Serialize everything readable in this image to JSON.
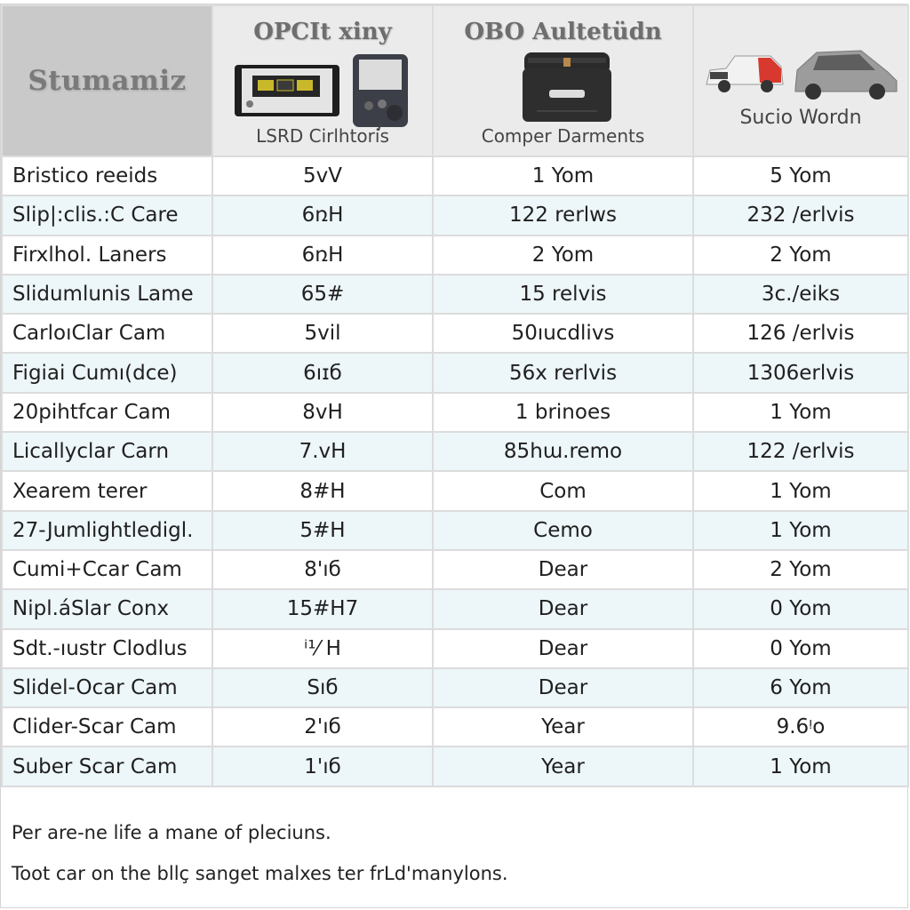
{
  "table": {
    "corner_title": "Stumamiz",
    "columns": [
      {
        "title": "OPCIt xiny",
        "subtitle": "LSRD Cirlhtoris",
        "image": "obd-scanner-devices-image"
      },
      {
        "title": "OBO Aultetüdn",
        "subtitle": "Comper Darments",
        "image": "obd-adapter-device-image"
      },
      {
        "title": "",
        "subtitle": "Sucio Wordn",
        "image": "cars-image"
      }
    ],
    "rows": [
      {
        "label": "Bristico reeids",
        "values": [
          "5vV",
          "1 Yom",
          "5 Yom"
        ]
      },
      {
        "label": "Slip|:clis.:C Care",
        "values": [
          "6ռH",
          "122 rerlws",
          "232 /erlvis"
        ]
      },
      {
        "label": "Firxlhol. Laners",
        "values": [
          "6ռH",
          "2 Yom",
          "2 Yom"
        ]
      },
      {
        "label": "Slidumlunis Lame",
        "values": [
          "65#",
          "15 relvis",
          "3c./eiks"
        ]
      },
      {
        "label": "CarloıClar Cam",
        "values": [
          "5vil",
          "50ıucdlivs",
          "126 /erlvis"
        ]
      },
      {
        "label": "Figiai Cumı(dce)",
        "values": [
          "6ıɪб",
          "56x rerlvis",
          "1306erlvis"
        ]
      },
      {
        "label": "20pihtfcar Cam",
        "values": [
          "8vH",
          "1 brinoes",
          "1 Yom"
        ]
      },
      {
        "label": "Licallyclar Carn",
        "values": [
          "7.vH",
          "85hɯ.remo",
          "122 /erlvis"
        ]
      },
      {
        "label": "Xearem terer",
        "values": [
          "8#H",
          "Com",
          "1 Yom"
        ]
      },
      {
        "label": "27-Jumlightledigl.",
        "values": [
          "5#H",
          "Cemo",
          "1 Yom"
        ]
      },
      {
        "label": "Cumi+Ccar Cam",
        "values": [
          "8'ıб",
          "Dear",
          "2 Yom"
        ]
      },
      {
        "label": "Nipl.áSlar Conx",
        "values": [
          "15#H7",
          "Dear",
          "0 Yom"
        ]
      },
      {
        "label": "Sdt.-ıustr Clodlus",
        "values": [
          "ⁱ¹⁄ H",
          "Dear",
          "0 Yom"
        ]
      },
      {
        "label": "Slidel-Ocar Cam",
        "values": [
          "Sıб",
          "Dear",
          "6 Yom"
        ]
      },
      {
        "label": "Clider-Scar Cam",
        "values": [
          "2'ıб",
          "Year",
          "9.6ᵎo"
        ]
      },
      {
        "label": "Suber Scar Cam",
        "values": [
          "1'ıб",
          "Year",
          "1 Yom"
        ]
      }
    ]
  },
  "notes": [
    "Per are-ne life a mane of pleciuns.",
    "Toot car on the bllç sanget malxes ter frLd'manylons."
  ]
}
